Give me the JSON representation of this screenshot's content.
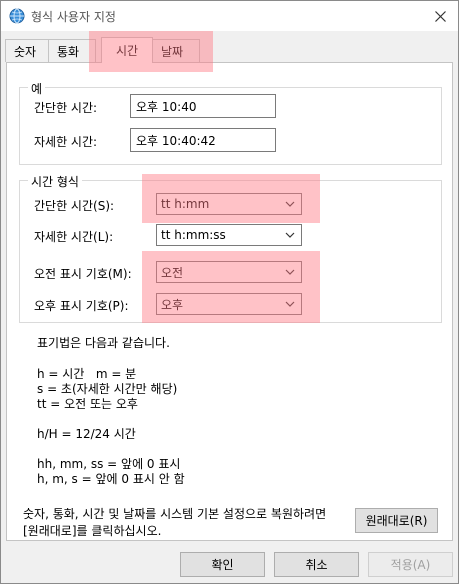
{
  "window": {
    "title": "형식 사용자 지정",
    "close_icon": "close-icon",
    "app_icon": "globe-icon"
  },
  "tabs": [
    {
      "label": "숫자"
    },
    {
      "label": "통화"
    },
    {
      "label": "시간",
      "active": true
    },
    {
      "label": "날짜"
    }
  ],
  "example": {
    "group_title": "예",
    "short_time_label": "간단한 시간:",
    "short_time_value": "오후 10:40",
    "long_time_label": "자세한 시간:",
    "long_time_value": "오후 10:40:42"
  },
  "time_format": {
    "group_title": "시간 형식",
    "short_time_label": "간단한 시간(S):",
    "short_time_value": "tt h:mm",
    "long_time_label": "자세한 시간(L):",
    "long_time_value": "tt h:mm:ss",
    "am_label": "오전 표시 기호(M):",
    "am_value": "오전",
    "pm_label": "오후 표시 기호(P):",
    "pm_value": "오후"
  },
  "notation": {
    "heading": "표기법은 다음과 같습니다.",
    "line1": "h = 시간   m = 분",
    "line2": "s = 초(자세한 시간만 해당)",
    "line3": "tt = 오전 또는 오후",
    "line4": "h/H = 12/24 시간",
    "line5": "hh, mm, ss = 앞에 0 표시",
    "line6": "h, m, s = 앞에 0 표시 안 함"
  },
  "restore": {
    "text": "숫자, 통화, 시간 및 날짜를 시스템 기본 설정으로 복원하려면 [원래대로]를 클릭하십시오.",
    "button_label": "원래대로(R)"
  },
  "footer": {
    "ok_label": "확인",
    "cancel_label": "취소",
    "apply_label": "적용(A)"
  },
  "colors": {
    "highlight": "#ff7882"
  }
}
